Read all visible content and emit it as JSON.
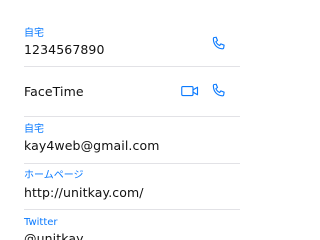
{
  "contact": {
    "phone_home": {
      "label": "自宅",
      "value": "1234567890",
      "action_icon": "phone-icon"
    },
    "facetime": {
      "value": "FaceTime",
      "video_icon": "video-camera-icon",
      "audio_icon": "phone-icon"
    },
    "email_home": {
      "label": "自宅",
      "value": "kay4web@gmail.com"
    },
    "homepage": {
      "label": "ホームページ",
      "value": "http://unitkay.com/"
    },
    "twitter": {
      "label": "Twitter",
      "value": "@unitkay"
    }
  },
  "colors": {
    "accent": "#0a7aff",
    "text": "#111111",
    "separator": "#e2e2e6",
    "background": "#ffffff"
  }
}
